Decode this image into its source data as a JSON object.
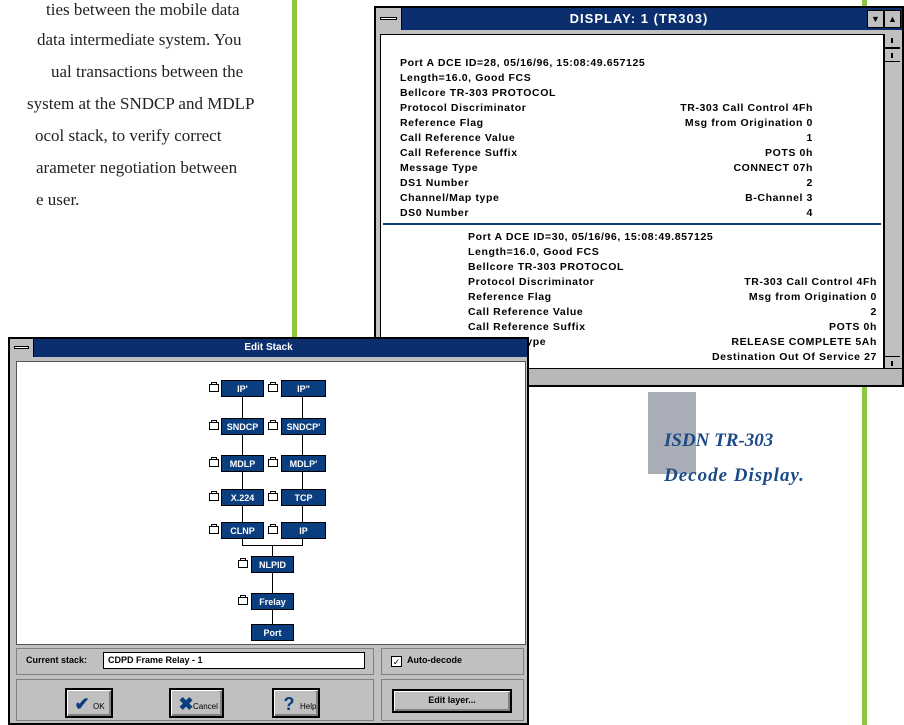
{
  "paragraph": {
    "lines": [
      "ties between the mobile data",
      "data intermediate system. You",
      "ual transactions between the",
      "system at the SNDCP and MDLP",
      "ocol stack, to verify correct",
      "arameter negotiation between",
      "e user."
    ]
  },
  "display_window": {
    "title": "DISPLAY: 1 (TR303)",
    "frame1": {
      "header": [
        "Port A DCE ID=28, 05/16/96, 15:08:49.657125",
        "Length=16.0, Good FCS",
        "Bellcore TR-303 PROTOCOL"
      ],
      "rows": [
        {
          "label": "Protocol Discriminator",
          "value": "TR-303 Call Control 4Fh"
        },
        {
          "label": "Reference Flag",
          "value": "Msg from Origination 0"
        },
        {
          "label": "Call Reference Value",
          "value": "1"
        },
        {
          "label": "Call Reference Suffix",
          "value": "POTS 0h"
        },
        {
          "label": "Message Type",
          "value": "CONNECT 07h"
        },
        {
          "label": "DS1 Number",
          "value": "2"
        },
        {
          "label": "Channel/Map type",
          "value": "B-Channel 3"
        },
        {
          "label": "DS0 Number",
          "value": "4"
        }
      ]
    },
    "frame2": {
      "header": [
        "Port A DCE ID=30, 05/16/96, 15:08:49.857125",
        "Length=16.0, Good FCS",
        "Bellcore TR-303 PROTOCOL"
      ],
      "rows": [
        {
          "label": "Protocol Discriminator",
          "value": "TR-303 Call Control 4Fh"
        },
        {
          "label": "Reference Flag",
          "value": "Msg from Origination 0"
        },
        {
          "label": "Call Reference Value",
          "value": "2"
        },
        {
          "label": "Call Reference Suffix",
          "value": "POTS 0h"
        },
        {
          "label": "Message Type",
          "value": "RELEASE COMPLETE 5Ah"
        },
        {
          "label": "",
          "value": "Destination Out Of Service 27"
        }
      ]
    }
  },
  "caption": {
    "line1": "ISDN TR-303",
    "line2": "Decode Display."
  },
  "edit_stack": {
    "title": "Edit Stack",
    "nodes": {
      "ip_prime": "IP'",
      "ip_dprime": "IP\"",
      "sndcp": "SNDCP",
      "sndcp_prime": "SNDCP'",
      "mdlp": "MDLP",
      "mdlp_prime": "MDLP'",
      "x224": "X.224",
      "tcp": "TCP",
      "clnp": "CLNP",
      "ip": "IP",
      "nlpid": "NLPID",
      "frelay": "Frelay",
      "port": "Port"
    },
    "current_stack_label": "Current stack:",
    "current_stack_value": "CDPD Frame Relay - 1",
    "auto_decode_label": "Auto-decode",
    "auto_decode_checked": true,
    "ok_label": "OK",
    "cancel_label": "Cancel",
    "help_label": "Help",
    "edit_layer_label": "Edit layer..."
  },
  "colors": {
    "accent_green": "#8dc63f",
    "title_blue": "#0a2e6e",
    "node_blue": "#0a3e7e",
    "caption_blue": "#1b4a86"
  }
}
